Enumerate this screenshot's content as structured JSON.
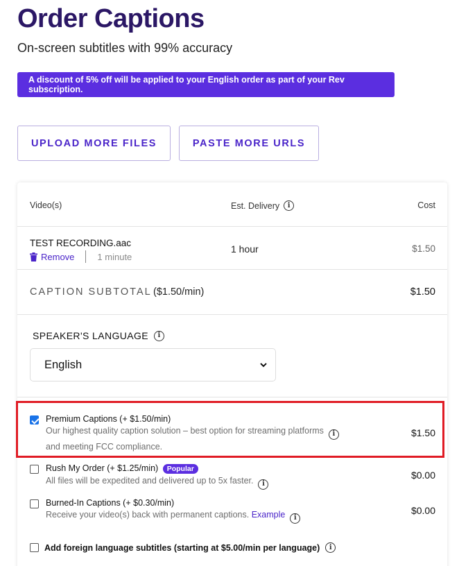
{
  "header": {
    "title": "Order Captions",
    "subtitle": "On-screen subtitles with 99% accuracy"
  },
  "discount_banner": "A discount of 5% off will be applied to your English order as part of your Rev subscription.",
  "buttons": {
    "upload": "UPLOAD MORE FILES",
    "paste": "PASTE MORE URLS"
  },
  "table": {
    "col_videos": "Video(s)",
    "col_delivery": "Est. Delivery",
    "col_cost": "Cost",
    "file": {
      "name": "TEST RECORDING.aac",
      "remove": "Remove",
      "duration": "1 minute",
      "delivery": "1 hour",
      "cost": "$1.50"
    }
  },
  "subtotal": {
    "label": "CAPTION SUBTOTAL",
    "rate": "($1.50/min)",
    "value": "$1.50"
  },
  "language": {
    "label": "SPEAKER'S LANGUAGE",
    "selected": "English"
  },
  "options": {
    "premium": {
      "title": "Premium Captions (+ $1.50/min)",
      "desc_line1": "Our highest quality caption solution – best option for streaming platforms",
      "desc_line2": "and meeting FCC compliance.",
      "cost": "$1.50",
      "checked": true
    },
    "rush": {
      "title": "Rush My Order (+ $1.25/min)",
      "badge": "Popular",
      "desc": "All files will be expedited and delivered up to 5x faster.",
      "cost": "$0.00",
      "checked": false
    },
    "burned": {
      "title": "Burned-In Captions (+ $0.30/min)",
      "desc": "Receive your video(s) back with permanent captions.",
      "link": "Example",
      "cost": "$0.00",
      "checked": false
    },
    "foreign": {
      "label": "Add foreign language subtitles (starting at $5.00/min per language)",
      "checked": false
    }
  },
  "colors": {
    "brand_dark": "#2b1765",
    "accent": "#5b2ee0",
    "link": "#4a24c9",
    "highlight": "#e01b24"
  }
}
